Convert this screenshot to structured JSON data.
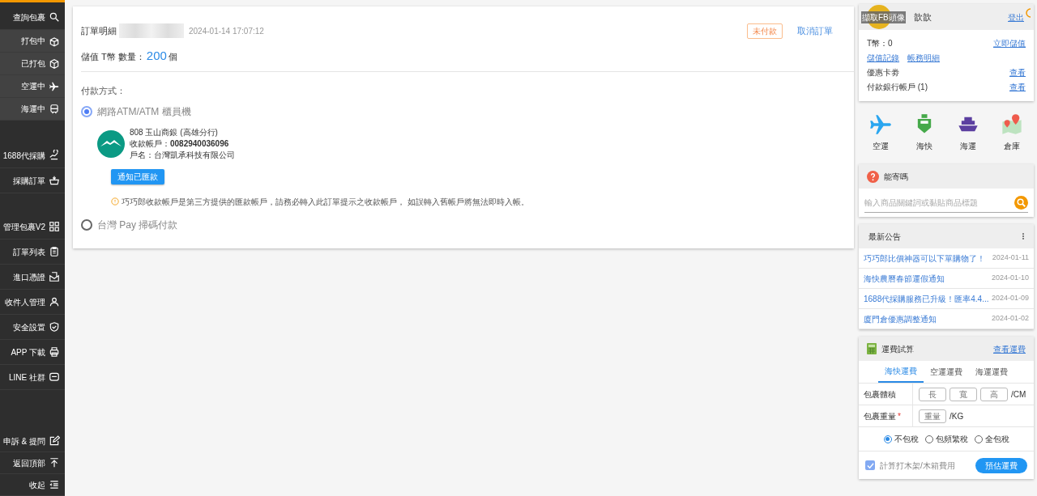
{
  "sidebar": {
    "sections": [
      {
        "items": [
          {
            "label": "查詢包裹",
            "kind": "main"
          },
          {
            "label": "打包中",
            "kind": "sub"
          },
          {
            "label": "已打包",
            "kind": "sub"
          },
          {
            "label": "空運中",
            "kind": "sub"
          },
          {
            "label": "海運中",
            "kind": "sub"
          }
        ]
      },
      {
        "items": [
          {
            "label": "1688代採購",
            "kind": "main"
          },
          {
            "label": "採購訂單",
            "kind": "main"
          }
        ]
      },
      {
        "items": [
          {
            "label": "管理包裹V2",
            "kind": "main"
          },
          {
            "label": "訂單列表",
            "kind": "main"
          },
          {
            "label": "進口憑證",
            "kind": "main"
          },
          {
            "label": "收件人管理",
            "kind": "main"
          },
          {
            "label": "安全設置",
            "kind": "main"
          },
          {
            "label": "APP 下載",
            "kind": "main"
          },
          {
            "label": "LINE 社群",
            "kind": "main"
          }
        ]
      },
      {
        "items": [
          {
            "label": "申訴 & 提問",
            "kind": "main"
          },
          {
            "label": "返回頂部",
            "kind": "main"
          },
          {
            "label": "收起",
            "kind": "main"
          }
        ]
      }
    ]
  },
  "order": {
    "title": "訂單明細",
    "date": "2024-01-14 17:07:12",
    "status": "未付款",
    "cancel": "取消訂單",
    "amount_label": "儲值 T幣 數量：",
    "amount": "200",
    "amount_unit": "個",
    "payment_label": "付款方式：",
    "methods": [
      {
        "label": "網路ATM/ATM 櫃員機",
        "selected": true,
        "bank": "808 玉山商銀 (高雄分行)",
        "account_label": "收款帳戶：",
        "account": "0082940036096",
        "holder": "戶名：台灣凱承科技有限公司",
        "button": "通知已匯款",
        "note": "巧巧郎收款帳戶是第三方提供的匯款帳戶，請務必轉入此訂單提示之收款帳戶， 如誤轉入舊帳戶將無法即時入帳。"
      },
      {
        "label": "台灣 Pay 掃碼付款",
        "selected": false
      }
    ]
  },
  "user": {
    "avatar_caption": "擷取FB頭像",
    "name": "歆歆",
    "logout": "登出",
    "coins": "T幣：0",
    "topup": "立即儲值",
    "links": [
      "儲值記錄",
      "帳務明細"
    ],
    "rows": [
      {
        "label": "優惠卡劵",
        "action": "查看"
      },
      {
        "label": "付款銀行帳戶 (1)",
        "action": "查看"
      }
    ]
  },
  "shortcuts": [
    {
      "label": "空運",
      "kind": "plane"
    },
    {
      "label": "海快",
      "kind": "ferry"
    },
    {
      "label": "海運",
      "kind": "ship"
    },
    {
      "label": "倉庫",
      "kind": "map"
    }
  ],
  "lookup": {
    "title": "能寄嗎",
    "placeholder": "輸入商品關鍵詞或黏貼商品標題"
  },
  "news": {
    "title": "最新公告",
    "items": [
      {
        "title": "巧巧郎比價神器可以下單購物了！",
        "date": "2024-01-11"
      },
      {
        "title": "海快農曆春節運假通知",
        "date": "2024-01-10"
      },
      {
        "title": "1688代採購服務已升級！匯率4.4...",
        "date": "2024-01-09"
      },
      {
        "title": "廈門倉優惠調整通知",
        "date": "2024-01-02"
      }
    ]
  },
  "calculator": {
    "title": "運費試算",
    "link": "查看運費",
    "tabs": [
      {
        "label": "海快運費",
        "selected": true
      },
      {
        "label": "空運運費",
        "selected": false
      },
      {
        "label": "海運運費",
        "selected": false
      }
    ],
    "volume_label": "包裹體積",
    "volume_fields": [
      {
        "placeholder": "長"
      },
      {
        "placeholder": "寬"
      },
      {
        "placeholder": "高"
      }
    ],
    "volume_unit": "/CM",
    "weight_label": "包裹重量",
    "required": "*",
    "weight_fields": [
      {
        "placeholder": "重量"
      }
    ],
    "weight_unit": "/KG",
    "tax": [
      {
        "label": "不包稅",
        "selected": true
      },
      {
        "label": "包頻繁稅",
        "selected": false
      },
      {
        "label": "全包稅",
        "selected": false
      }
    ],
    "crate": {
      "label": "計算打木架/木箱費用",
      "checked": true
    },
    "estimate": "預估運費"
  }
}
